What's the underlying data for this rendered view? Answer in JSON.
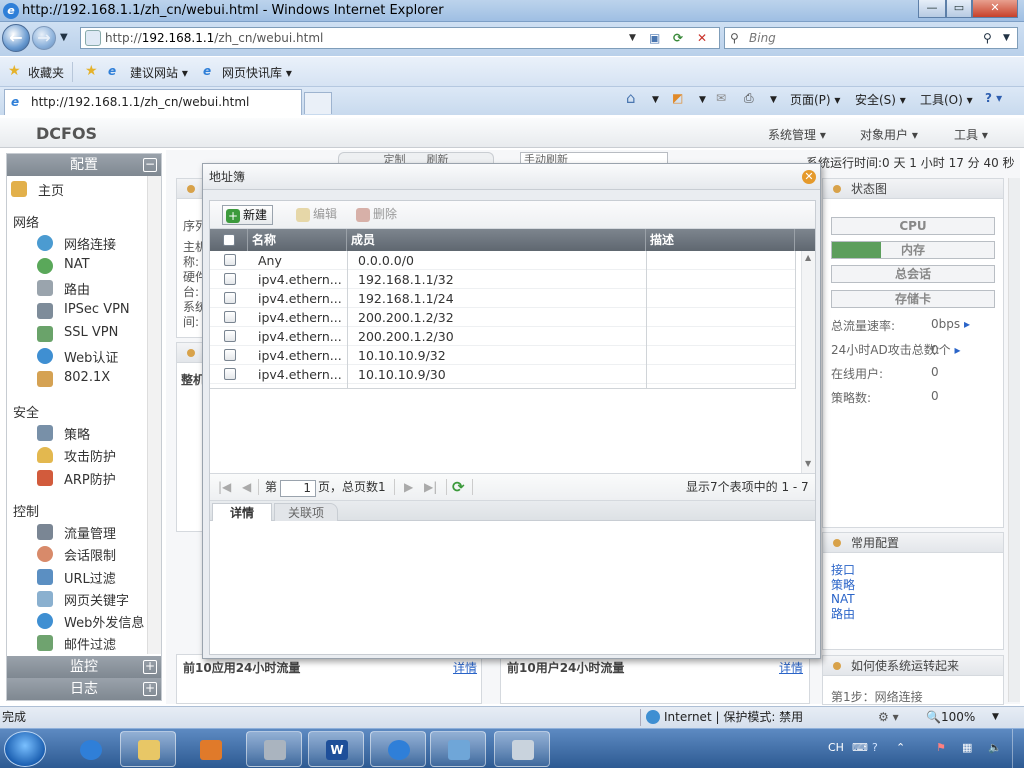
{
  "browser": {
    "window_title": "http://192.168.1.1/zh_cn/webui.html - Windows Internet Explorer",
    "address_prefix": "http://",
    "address_host": "192.168.1.1",
    "address_path": "/zh_cn/webui.html",
    "search_placeholder": "Bing",
    "favorites_label": "收藏夹",
    "favorites_bar": [
      "建议网站 ▾",
      "网页快讯库 ▾"
    ],
    "tab_title": "http://192.168.1.1/zh_cn/webui.html",
    "command_bar": {
      "page": "页面(P) ▾",
      "safety": "安全(S) ▾",
      "tools": "工具(O) ▾",
      "help": "? ▾"
    }
  },
  "app": {
    "logo": "DCFOS",
    "top_menu": [
      "系统管理 ▾",
      "对象用户 ▾",
      "工具 ▾"
    ],
    "runtime_text": "系统运行时间:0 天 1 小时 17 分 40 秒"
  },
  "sidebar": {
    "config_header": "配置",
    "home": "主页",
    "groups": [
      {
        "title": "网络",
        "items": [
          "网络连接",
          "NAT",
          "路由",
          "IPSec VPN",
          "SSL VPN",
          "Web认证",
          "802.1X"
        ]
      },
      {
        "title": "安全",
        "items": [
          "策略",
          "攻击防护",
          "ARP防护"
        ]
      },
      {
        "title": "控制",
        "items": [
          "流量管理",
          "会话限制",
          "URL过滤",
          "网页关键字",
          "Web外发信息",
          "邮件过滤"
        ]
      }
    ],
    "monitor_header": "监控",
    "log_header": "日志"
  },
  "background": {
    "sysinfo_labels": [
      "序列",
      "主机",
      "称:",
      "硬件",
      "台:",
      "系统",
      "间:"
    ],
    "partial_tabs": [
      "定制",
      "刷新",
      "手动刷新"
    ],
    "whole_label": "整机",
    "status_panel": {
      "title": "状态图",
      "bars": [
        "CPU",
        "内存",
        "总会话",
        "存储卡"
      ],
      "memory_usage_fraction": 0.3,
      "stats": [
        {
          "label": "总流量速率:",
          "value": "0bps"
        },
        {
          "label": "24小时AD攻击总数:",
          "value": "0个"
        },
        {
          "label": "在线用户:",
          "value": "0"
        },
        {
          "label": "策略数:",
          "value": "0"
        }
      ]
    },
    "common_config": {
      "title": "常用配置",
      "links": [
        "接口",
        "策略",
        "NAT",
        "路由"
      ]
    },
    "howto": {
      "title": "如何使系统运转起来",
      "step1": "第1步：网络连接"
    },
    "bottom_panels": [
      {
        "title": "前10应用24小时流量",
        "link": "详情"
      },
      {
        "title": "前10用户24小时流量",
        "link": "详情"
      }
    ]
  },
  "dialog": {
    "title": "地址簿",
    "toolbar": {
      "new": "新建",
      "edit": "编辑",
      "delete": "删除"
    },
    "columns": {
      "name": "名称",
      "members": "成员",
      "description": "描述"
    },
    "rows": [
      {
        "name": "Any",
        "member": "0.0.0.0/0",
        "desc": ""
      },
      {
        "name": "ipv4.ethern...",
        "member": "192.168.1.1/32",
        "desc": ""
      },
      {
        "name": "ipv4.ethern...",
        "member": "192.168.1.1/24",
        "desc": ""
      },
      {
        "name": "ipv4.ethern...",
        "member": "200.200.1.2/32",
        "desc": ""
      },
      {
        "name": "ipv4.ethern...",
        "member": "200.200.1.2/30",
        "desc": ""
      },
      {
        "name": "ipv4.ethern...",
        "member": "10.10.10.9/32",
        "desc": ""
      },
      {
        "name": "ipv4.ethern...",
        "member": "10.10.10.9/30",
        "desc": ""
      }
    ],
    "pager": {
      "page_label_pre": "第",
      "page_value": "1",
      "page_label_post": "页，总页数1",
      "summary": "显示7个表项中的 1 - 7"
    },
    "tabs": {
      "details": "详情",
      "related": "关联项"
    }
  },
  "statusbar": {
    "left": "完成",
    "zone": "Internet | 保护模式: 禁用",
    "zoom": "100%"
  },
  "taskbar": {
    "lang": "CH"
  }
}
